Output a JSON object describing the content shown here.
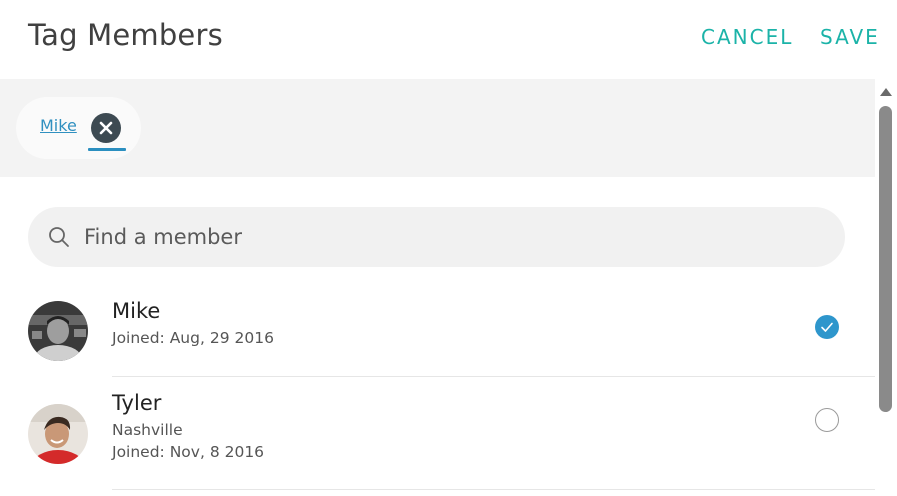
{
  "header": {
    "title": "Tag Members",
    "cancel_label": "CANCEL",
    "save_label": "SAVE"
  },
  "tags": [
    {
      "label": "Mike",
      "remove_icon": "close-circle-icon"
    }
  ],
  "search": {
    "placeholder": "Find a member",
    "value": "",
    "icon": "search-icon"
  },
  "members": [
    {
      "name": "Mike",
      "location": "",
      "joined": "Joined: Aug, 29 2016",
      "selected": true
    },
    {
      "name": "Tyler",
      "location": "Nashville",
      "joined": "Joined: Nov, 8 2016",
      "selected": false
    }
  ],
  "colors": {
    "accent": "#1bb3a8",
    "link": "#3090c0",
    "check": "#2e96cc",
    "tag_bar": "#f3f3f3"
  }
}
